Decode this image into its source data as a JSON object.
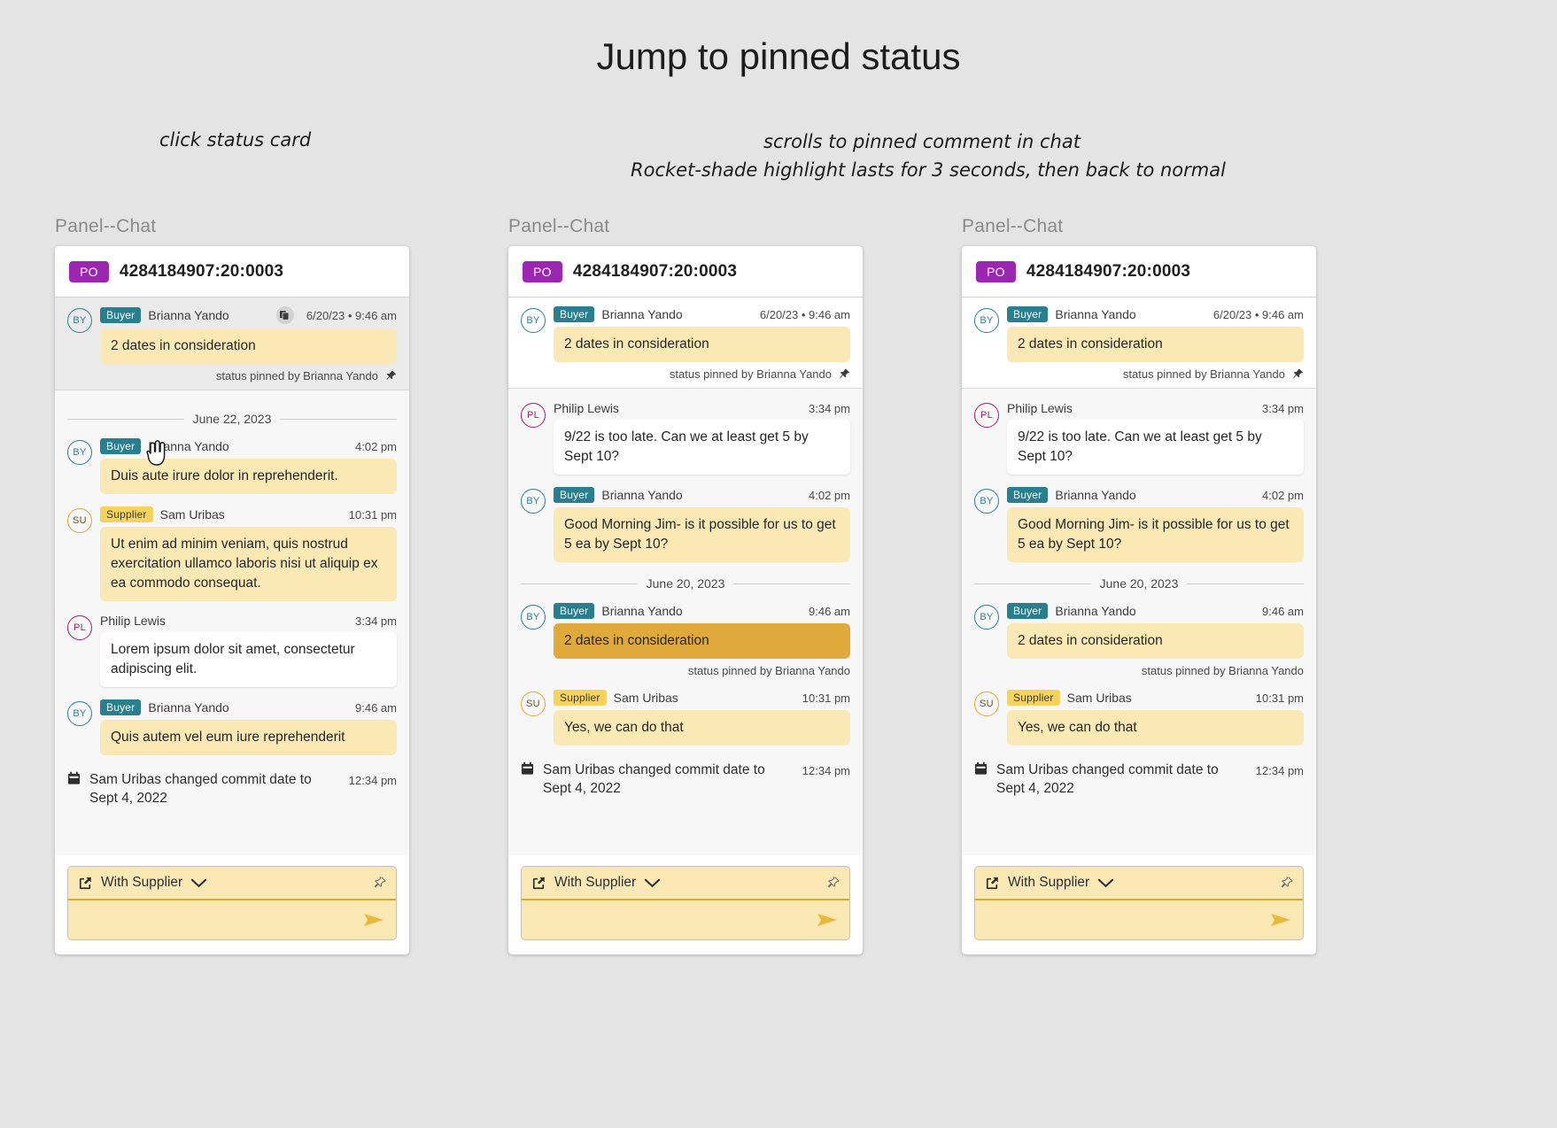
{
  "page": {
    "title": "Jump to pinned status",
    "annotation_left": "click status card",
    "annotation_right_1": "scrolls to pinned comment in chat",
    "annotation_right_2": "Rocket-shade highlight lasts for 3 seconds, then back to normal"
  },
  "colors": {
    "background": "#e4e4e4",
    "po_badge": "#9b27b0",
    "buyer_badge": "#2a7f8e",
    "supplier_badge": "#f5d35c",
    "bubble_yellow": "#fae9b4",
    "rocket_highlight": "#e0a93c",
    "composer_border": "#dbab2e",
    "avatar_buyer": "#2a7f8e",
    "avatar_supplier": "#e0a83a",
    "avatar_philip": "#a31c67"
  },
  "panels": [
    {
      "label": "Panel--Chat",
      "header": {
        "badge": "PO",
        "number": "4284184907:20:0003"
      },
      "pinned_banner": {
        "role": "Buyer",
        "name": "Brianna Yando",
        "timestamp": "6/20/23 • 9:46 am",
        "avatar": "BY",
        "text": "2 dates in consideration",
        "pin_note": "status pinned by Brianna Yando",
        "has_copy_icon": true
      },
      "messages": [
        {
          "kind": "date-divider",
          "label": "June 22, 2023"
        },
        {
          "kind": "message",
          "avatar": "BY",
          "avatar_style": "by",
          "role": "Buyer",
          "name": "Brianna Yando",
          "time": "4:02 pm",
          "text": "Duis aute irure dolor in reprehenderit.",
          "bubble": "yellow"
        },
        {
          "kind": "message",
          "avatar": "SU",
          "avatar_style": "su",
          "role": "Supplier",
          "name": "Sam Uribas",
          "time": "10:31 pm",
          "text": "Ut enim ad minim veniam, quis nostrud exercitation ullamco laboris nisi ut aliquip ex ea commodo consequat.",
          "bubble": "yellow"
        },
        {
          "kind": "message",
          "avatar": "PL",
          "avatar_style": "pl",
          "role": "",
          "name": "Philip Lewis",
          "time": "3:34 pm",
          "text": "Lorem ipsum dolor sit amet, consectetur adipiscing elit.",
          "bubble": "white"
        },
        {
          "kind": "message",
          "avatar": "BY",
          "avatar_style": "by",
          "role": "Buyer",
          "name": "Brianna Yando",
          "time": "9:46 am",
          "text": "Quis autem vel eum iure reprehenderit",
          "bubble": "yellow"
        },
        {
          "kind": "event",
          "icon": "calendar-icon",
          "text": "Sam Uribas changed commit date to Sept 4, 2022",
          "time": "12:34 pm"
        }
      ],
      "composer": {
        "status_label": "With Supplier",
        "placeholder": ""
      },
      "show_cursor": true
    },
    {
      "label": "Panel--Chat",
      "header": {
        "badge": "PO",
        "number": "4284184907:20:0003"
      },
      "pinned_banner": {
        "role": "Buyer",
        "name": "Brianna Yando",
        "timestamp": "6/20/23 • 9:46 am",
        "avatar": "BY",
        "text": "2 dates in consideration",
        "pin_note": "status pinned by Brianna Yando",
        "has_copy_icon": false
      },
      "messages": [
        {
          "kind": "message",
          "avatar": "PL",
          "avatar_style": "pl",
          "role": "",
          "name": "Philip Lewis",
          "time": "3:34 pm",
          "text": "9/22 is too late. Can we at least get 5 by Sept 10?",
          "bubble": "white"
        },
        {
          "kind": "message",
          "avatar": "BY",
          "avatar_style": "by",
          "role": "Buyer",
          "name": "Brianna Yando",
          "time": "4:02 pm",
          "text": "Good Morning Jim- is it possible for us to get 5 ea by Sept 10?",
          "bubble": "yellow"
        },
        {
          "kind": "date-divider",
          "label": "June 20, 2023"
        },
        {
          "kind": "message",
          "avatar": "BY",
          "avatar_style": "by",
          "role": "Buyer",
          "name": "Brianna Yando",
          "time": "9:46 am",
          "text": "2 dates in consideration",
          "bubble": "rocket",
          "pin_note": "status pinned by Brianna Yando"
        },
        {
          "kind": "message",
          "avatar": "SU",
          "avatar_style": "su",
          "role": "Supplier",
          "name": "Sam Uribas",
          "time": "10:31 pm",
          "text": "Yes, we can do that",
          "bubble": "yellow"
        },
        {
          "kind": "event",
          "icon": "calendar-icon",
          "text": "Sam Uribas changed commit date to Sept 4, 2022",
          "time": "12:34 pm"
        }
      ],
      "composer": {
        "status_label": "With Supplier",
        "placeholder": ""
      },
      "show_cursor": false
    },
    {
      "label": "Panel--Chat",
      "header": {
        "badge": "PO",
        "number": "4284184907:20:0003"
      },
      "pinned_banner": {
        "role": "Buyer",
        "name": "Brianna Yando",
        "timestamp": "6/20/23 • 9:46 am",
        "avatar": "BY",
        "text": "2 dates in consideration",
        "pin_note": "status pinned by Brianna Yando",
        "has_copy_icon": false
      },
      "messages": [
        {
          "kind": "message",
          "avatar": "PL",
          "avatar_style": "pl",
          "role": "",
          "name": "Philip Lewis",
          "time": "3:34 pm",
          "text": "9/22 is too late. Can we at least get 5 by Sept 10?",
          "bubble": "white"
        },
        {
          "kind": "message",
          "avatar": "BY",
          "avatar_style": "by",
          "role": "Buyer",
          "name": "Brianna Yando",
          "time": "4:02 pm",
          "text": "Good Morning Jim- is it possible for us to get 5 ea by Sept 10?",
          "bubble": "yellow"
        },
        {
          "kind": "date-divider",
          "label": "June 20, 2023"
        },
        {
          "kind": "message",
          "avatar": "BY",
          "avatar_style": "by",
          "role": "Buyer",
          "name": "Brianna Yando",
          "time": "9:46 am",
          "text": "2 dates in consideration",
          "bubble": "yellow",
          "pin_note": "status pinned by Brianna Yando"
        },
        {
          "kind": "message",
          "avatar": "SU",
          "avatar_style": "su",
          "role": "Supplier",
          "name": "Sam Uribas",
          "time": "10:31 pm",
          "text": "Yes, we can do that",
          "bubble": "yellow"
        },
        {
          "kind": "event",
          "icon": "calendar-icon",
          "text": "Sam Uribas changed commit date to Sept 4, 2022",
          "time": "12:34 pm"
        }
      ],
      "composer": {
        "status_label": "With Supplier",
        "placeholder": ""
      },
      "show_cursor": false
    }
  ]
}
